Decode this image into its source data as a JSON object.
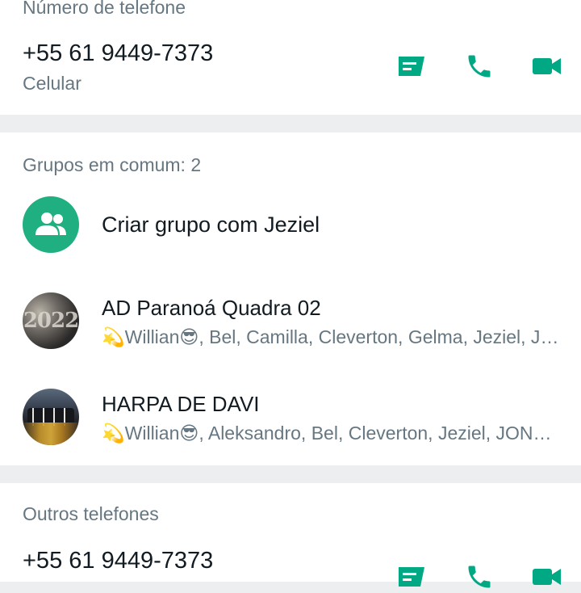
{
  "phone_section": {
    "title": "Número de telefone",
    "number": "+55 61 9449-7373",
    "type": "Celular"
  },
  "groups_section": {
    "title": "Grupos em comum: 2",
    "create_label": "Criar grupo com Jeziel",
    "groups": [
      {
        "name": "AD Paranoá Quadra 02",
        "members": "💫Willian😎, Bel, Camilla, Cleverton, Gelma, Jeziel, JOSIANE, Lê, Maria, Vitória",
        "avatar_text": "2022"
      },
      {
        "name": "HARPA DE DAVI",
        "members": "💫Willian😎, Aleksandro, Bel, Cleverton, Jeziel, JONATHAN, Levi"
      }
    ]
  },
  "others_section": {
    "title": "Outros telefones",
    "number": "+55 61 9449-7373"
  },
  "icons": {
    "message": "message-icon",
    "call": "phone-icon",
    "video": "video-icon",
    "create_group": "group-add-icon"
  },
  "colors": {
    "accent": "#1faf81",
    "icon_green": "#00a884",
    "primary_text": "#111b21",
    "secondary_text": "#667781",
    "background": "#eceeef"
  }
}
